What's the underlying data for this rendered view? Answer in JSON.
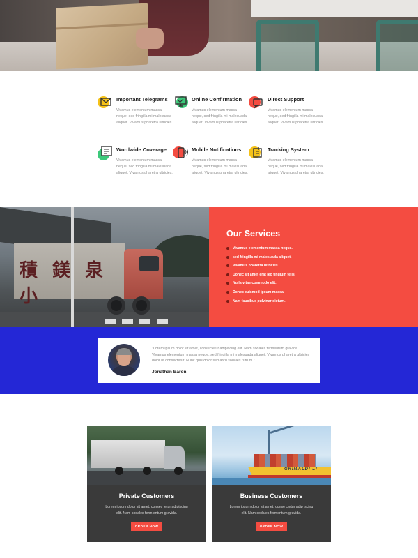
{
  "colors": {
    "accent_red": "#f44c41",
    "band_blue": "#2427d6",
    "card_dark": "#3a3a3a",
    "icon_yellow": "#f5c21a",
    "icon_green": "#3cc97a",
    "icon_red": "#f44c41"
  },
  "features": [
    {
      "title": "Important Telegrams",
      "text": "Vivamus elementum massa neque, sed fringilla mi malesuada aliquet. Vivamus pharetra ultricies.",
      "icon": "envelope-icon",
      "blob": "yellow"
    },
    {
      "title": "Online Confirmation",
      "text": "Vivamus elementum massa neque, sed fringilla mi malesuada aliquet. Vivamus pharetra ultricies.",
      "icon": "monitor-icon",
      "blob": "green"
    },
    {
      "title": "Direct Support",
      "text": "Vivamus elementum massa neque, sed fringilla mi malesuada aliquet. Vivamus pharetra ultricies.",
      "icon": "chat-icon",
      "blob": "red"
    },
    {
      "title": "Wordwide Coverage",
      "text": "Vivamus elementum massa neque, sed fringilla mi malesuada aliquet. Vivamus pharetra ultricies.",
      "icon": "document-icon",
      "blob": "green"
    },
    {
      "title": "Mobile Notifications",
      "text": "Vivamus elementum massa neque, sed fringilla mi malesuada aliquet. Vivamus pharetra ultricies.",
      "icon": "phone-icon",
      "blob": "red"
    },
    {
      "title": "Tracking System",
      "text": "Vivamus elementum massa neque, sed fringilla mi malesuada aliquet. Vivamus pharetra ultricies.",
      "icon": "tracking-icon",
      "blob": "yellow"
    }
  ],
  "services": {
    "title": "Our Services",
    "truck_lettering": "積 鎂 泉 小",
    "items": [
      "Vivamus elementum massa neque.",
      "sed fringilla mi malesuada aliquet.",
      "Vivamus pharetra ultricies.",
      "Donec sit amet erat leo tinulum felis.",
      "Nulla vitae commodo elit.",
      "Donec euismod ipsum massa.",
      "Nam faucibus pulvinar dictum."
    ]
  },
  "testimonial": {
    "quote": "\"Lorem ipsum dolor sit amet, consectetur adipiscing elit. Nam sodales fermentum gravida. Vivamus elementum massa neque, sed fringilla mi malesuada aliquet. Vivamus pharetra ultricies dolor ut consectetur. Nunc quis dolor sed arcu sodales rutrum.\"",
    "author": "Jonathan Baron"
  },
  "customers": [
    {
      "title": "Private Customers",
      "text": "Lorem ipsum dolor sit amet, consec tetur adipiscing elit. Nam sodales ferm entum gravida.",
      "button": "ORDER NOW"
    },
    {
      "title": "Business Customers",
      "text": "Lorem ipsum dolor sit amet, conse ctetur adip iscing elit. Nam sodales fermentum gravida.",
      "button": "ORDER NOW",
      "ship_name": "GRIMALDI LI"
    }
  ]
}
